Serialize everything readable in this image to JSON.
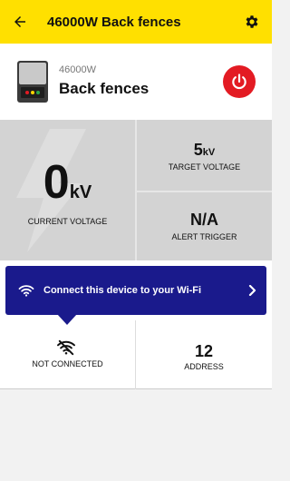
{
  "appbar": {
    "title": "46000W Back fences",
    "back_icon": "arrow-left-icon",
    "settings_icon": "gear-icon"
  },
  "device": {
    "model": "46000W",
    "name": "Back fences",
    "power_icon": "power-icon",
    "power_color": "#e31b23"
  },
  "stats": {
    "current_voltage": {
      "value": "0",
      "unit": "kV",
      "label": "CURRENT VOLTAGE"
    },
    "target_voltage": {
      "value": "5",
      "unit": "kV",
      "label": "TARGET VOLTAGE"
    },
    "alert_trigger": {
      "value": "N/A",
      "label": "ALERT TRIGGER"
    }
  },
  "wifi_banner": {
    "text": "Connect this device to your Wi-Fi",
    "icon": "wifi-icon",
    "color": "#1a1a8c"
  },
  "connection": {
    "label": "NOT CONNECTED",
    "icon": "wifi-off-icon"
  },
  "address": {
    "value": "12",
    "label": "ADDRESS"
  },
  "colors": {
    "accent": "#ffe000",
    "stats_bg": "#d3d3d3"
  }
}
